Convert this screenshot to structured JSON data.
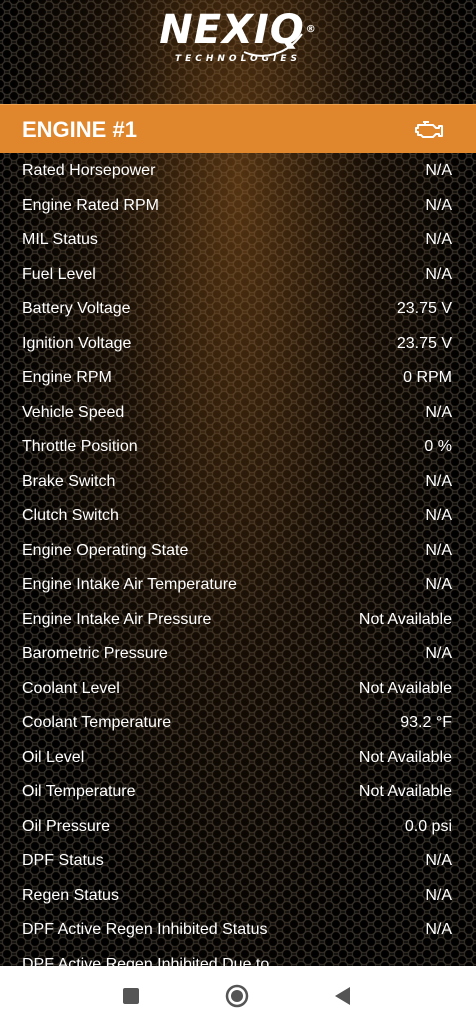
{
  "header": {
    "logo_text": "NEXIQ",
    "logo_reg": "®",
    "logo_subtitle": "TECHNOLOGIES"
  },
  "title_bar": {
    "title": "ENGINE #1",
    "icon": "engine-icon",
    "color": "#e0862c"
  },
  "rows": [
    {
      "label": "Rated Horsepower",
      "value": "N/A"
    },
    {
      "label": "Engine Rated RPM",
      "value": "N/A"
    },
    {
      "label": "MIL Status",
      "value": "N/A"
    },
    {
      "label": "Fuel Level",
      "value": "N/A"
    },
    {
      "label": "Battery Voltage",
      "value": "23.75 V"
    },
    {
      "label": "Ignition Voltage",
      "value": "23.75 V"
    },
    {
      "label": "Engine RPM",
      "value": "0 RPM"
    },
    {
      "label": "Vehicle Speed",
      "value": "N/A"
    },
    {
      "label": "Throttle Position",
      "value": "0 %"
    },
    {
      "label": "Brake Switch",
      "value": "N/A"
    },
    {
      "label": "Clutch Switch",
      "value": "N/A"
    },
    {
      "label": "Engine Operating State",
      "value": "N/A"
    },
    {
      "label": "Engine Intake Air Temperature",
      "value": "N/A"
    },
    {
      "label": "Engine Intake Air Pressure",
      "value": "Not Available"
    },
    {
      "label": "Barometric Pressure",
      "value": "N/A"
    },
    {
      "label": "Coolant Level",
      "value": "Not Available"
    },
    {
      "label": "Coolant Temperature",
      "value": "93.2 °F"
    },
    {
      "label": "Oil Level",
      "value": "Not Available"
    },
    {
      "label": "Oil Temperature",
      "value": "Not Available"
    },
    {
      "label": "Oil Pressure",
      "value": "0.0 psi"
    },
    {
      "label": "DPF Status",
      "value": "N/A"
    },
    {
      "label": "Regen Status",
      "value": "N/A"
    },
    {
      "label": "DPF Active Regen Inhibited Status",
      "value": "N/A"
    },
    {
      "label": "DPF Active Regen Inhibited Due to",
      "value": ""
    }
  ],
  "nav": {
    "recents_icon": "square-icon",
    "home_icon": "circle-icon",
    "back_icon": "triangle-back-icon"
  }
}
